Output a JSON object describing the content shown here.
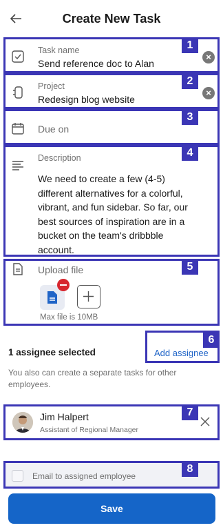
{
  "header": {
    "title": "Create New Task"
  },
  "task_name": {
    "label": "Task name",
    "value": "Send reference doc to Alan",
    "badge": "1"
  },
  "project": {
    "label": "Project",
    "value": "Redesign blog website",
    "badge": "2"
  },
  "due": {
    "placeholder": "Due on",
    "badge": "3"
  },
  "description": {
    "label": "Description",
    "value": "We need to create a few (4-5) different alternatives for a colorful, vibrant, and fun sidebar. So far, our best sources of inspiration are in a bucket on the team's dribbble account.",
    "badge": "4"
  },
  "upload": {
    "label": "Upload file",
    "hint": "Max file is 10MB",
    "badge": "5"
  },
  "assignees": {
    "heading": "1 assignee selected",
    "add_label": "Add assignee",
    "badge": "6",
    "subtext": "You also can create a separate tasks for other employees."
  },
  "person": {
    "name": "Jim Halpert",
    "role": "Assistant of Regional Manager",
    "badge": "7"
  },
  "email": {
    "label": "Email to assigned employee",
    "checked": false,
    "badge": "8"
  },
  "save_label": "Save",
  "colors": {
    "accent": "#3b36b5",
    "primary": "#1565c8",
    "link": "#1f64c7",
    "remove": "#d7262e"
  }
}
